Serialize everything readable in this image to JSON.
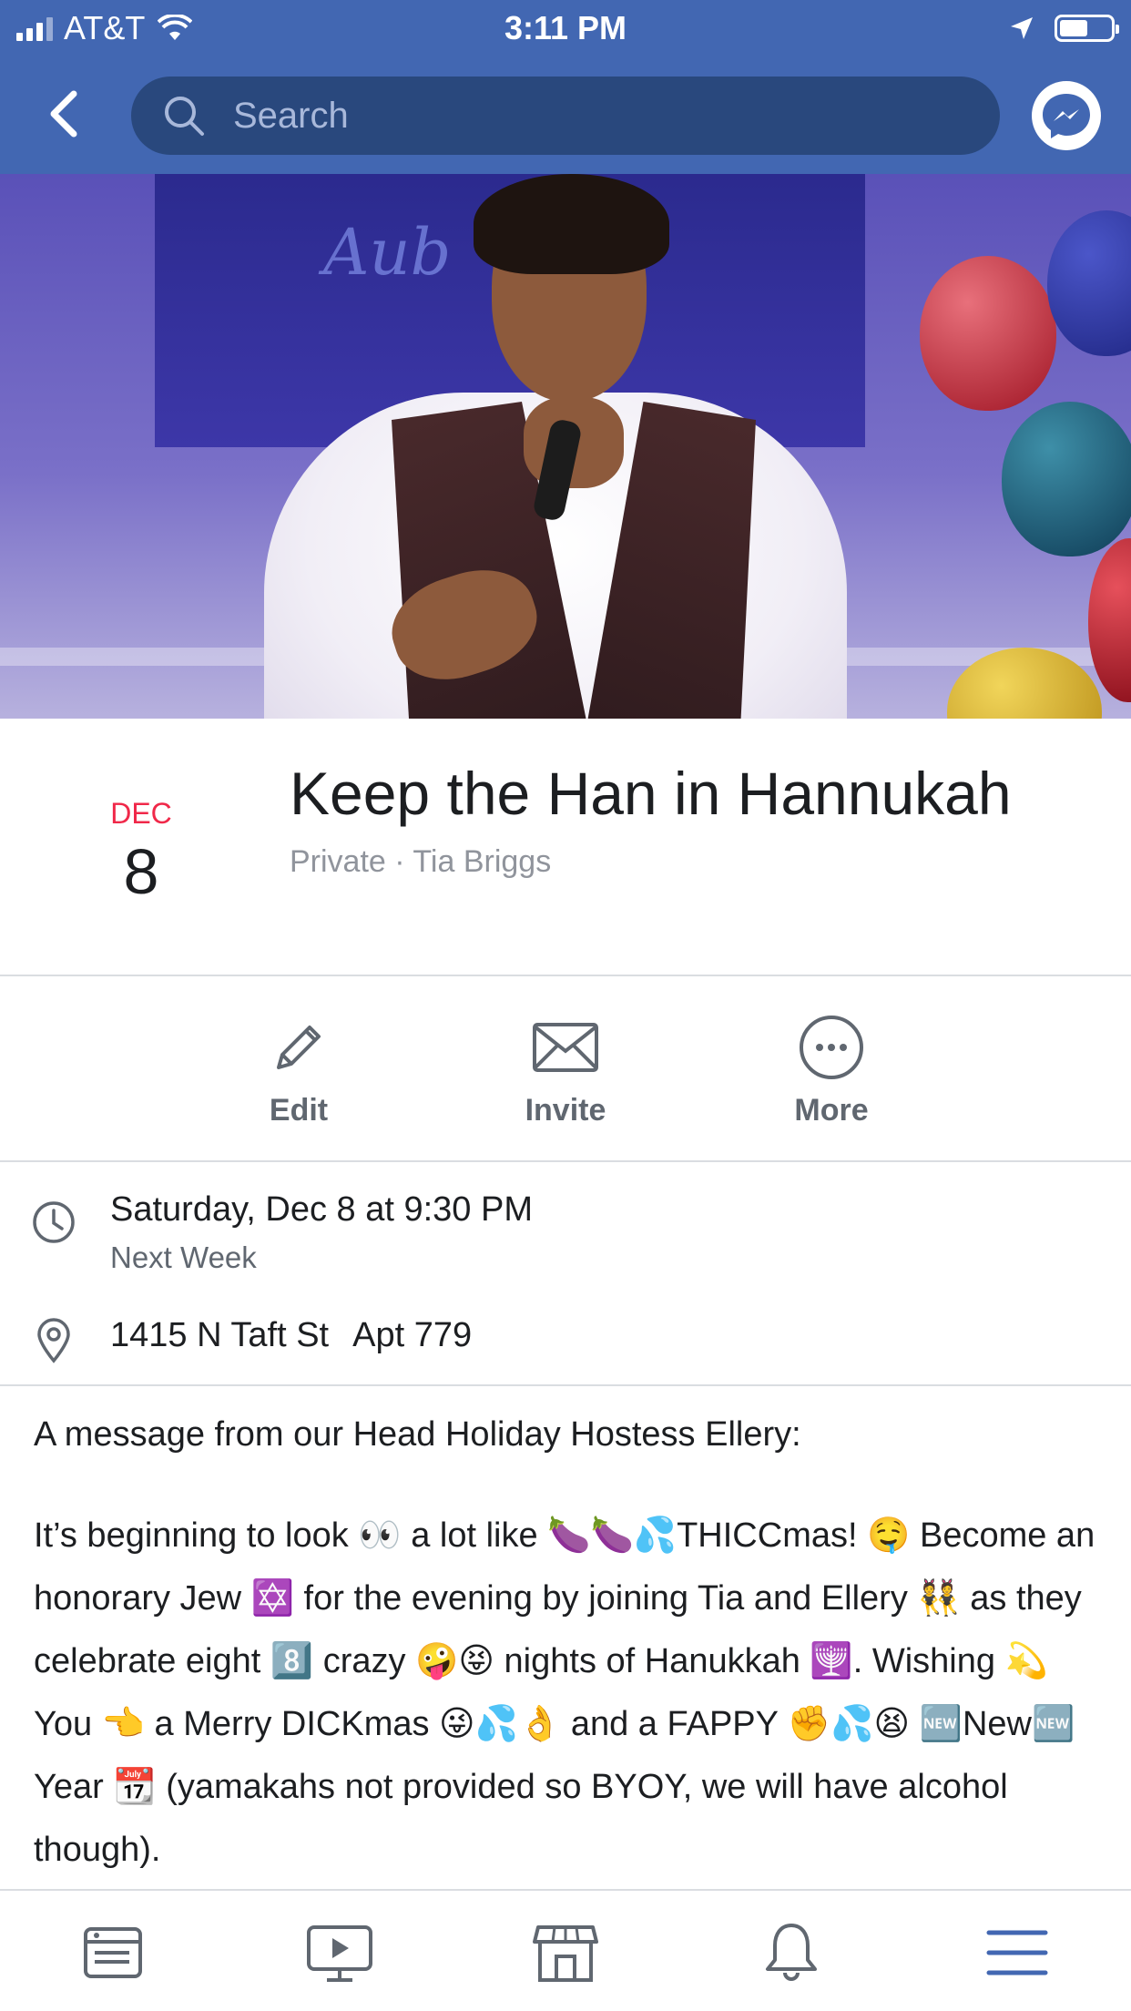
{
  "status_bar": {
    "carrier": "AT&T",
    "time": "3:11 PM",
    "battery_level": 0.55
  },
  "nav": {
    "search_placeholder": "Search"
  },
  "event": {
    "month": "DEC",
    "day": "8",
    "title": "Keep the Han in Hannukah",
    "meta": "Private · Tia Briggs"
  },
  "actions": {
    "edit": "Edit",
    "invite": "Invite",
    "more": "More"
  },
  "details": {
    "datetime": "Saturday, Dec 8 at 9:30 PM",
    "relative": "Next Week",
    "address": "1415 N Taft St",
    "apt": "Apt 779"
  },
  "description": {
    "intro": "A message from our Head Holiday Hostess Ellery:",
    "body": "It’s beginning to look 👀 a lot like 🍆🍆💦THICCmas! 🤤 Become an honorary Jew ✡️ for the evening by joining Tia and Ellery 👯 as they celebrate eight 8️⃣ crazy 🤪😝 nights of Hanukkah 🕎. Wishing 💫 You 👈 a Merry DICKmas 😜💦👌 and a FAPPY ✊💦😫 🆕New🆕 Year 📆 (yamakahs not provided so BYOY, we will have alcohol though)."
  },
  "tabs": [
    "news-feed-icon",
    "watch-icon",
    "marketplace-icon",
    "notifications-icon",
    "menu-icon"
  ],
  "colors": {
    "brand": "#4267b2",
    "search_bg": "#29487d",
    "date_red": "#f02849",
    "active_tab": "#4267b2"
  }
}
